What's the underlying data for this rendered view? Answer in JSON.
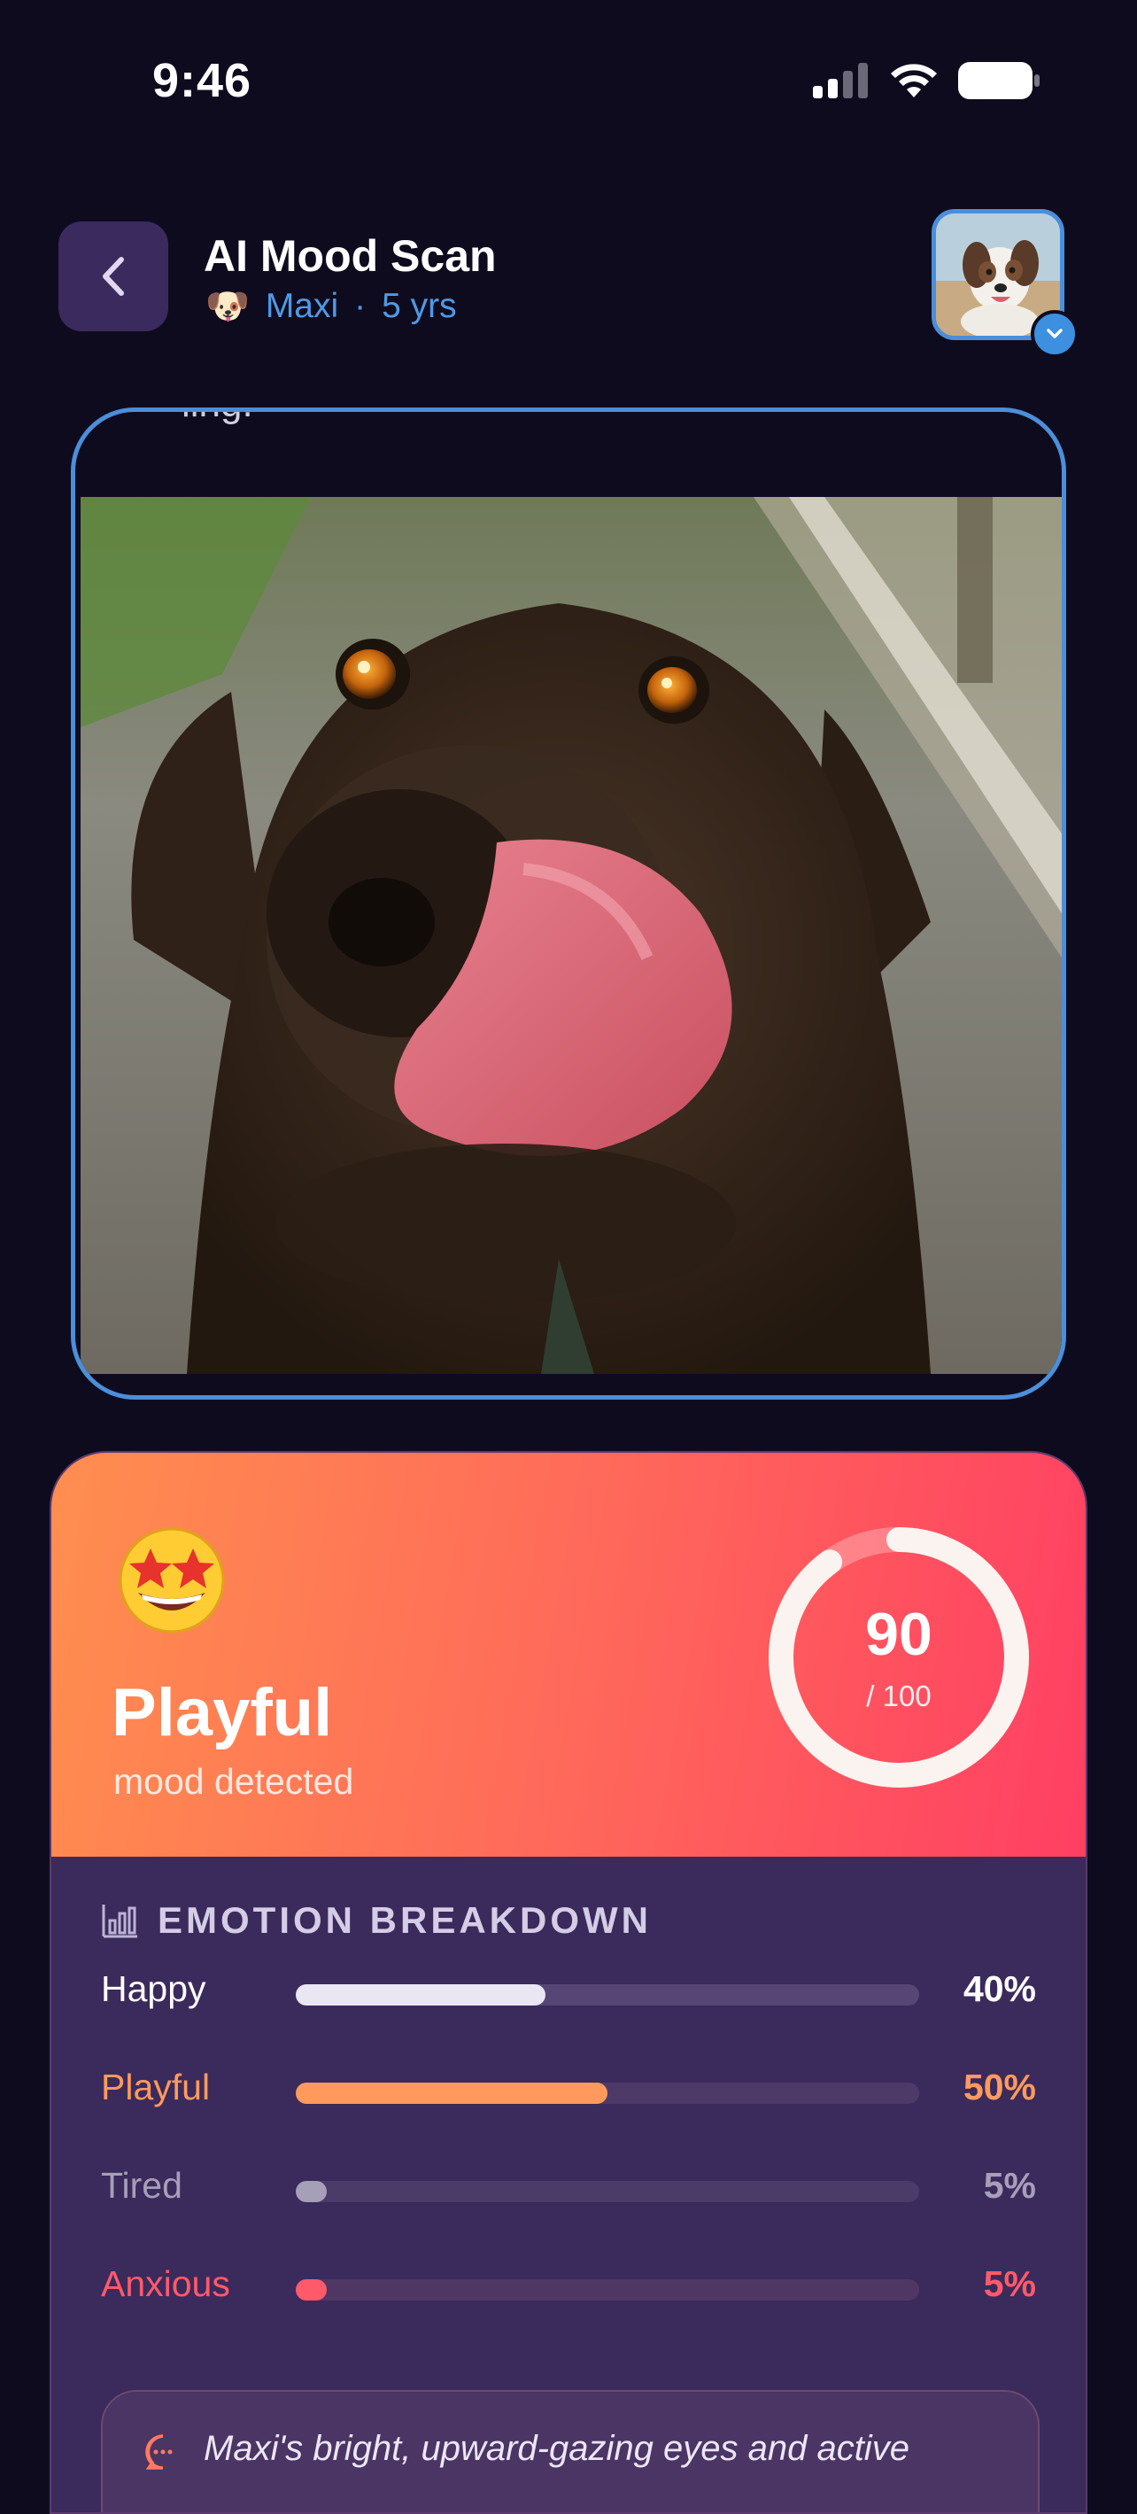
{
  "status": {
    "time": "9:46"
  },
  "header": {
    "title": "AI Mood Scan",
    "pet_name": "Maxi",
    "separator": "·",
    "pet_age": "5 yrs",
    "pet_emoji": "🐶"
  },
  "photo": {
    "caption_partial": "ling."
  },
  "result": {
    "emoji": "star-struck-face",
    "mood": "Playful",
    "mood_sub": "mood detected",
    "score": "90",
    "score_max": "/ 100",
    "score_fraction": 0.9
  },
  "breakdown": {
    "title": "EMOTION BREAKDOWN",
    "rows": [
      {
        "label": "Happy",
        "pct": "40%",
        "value": 40,
        "color": "#ffffff",
        "fill": "#ebe6f3",
        "track": "#564575"
      },
      {
        "label": "Playful",
        "pct": "50%",
        "value": 50,
        "color": "#ff9a5c",
        "fill": "#ff9a5c",
        "track": "#4e3a68"
      },
      {
        "label": "Tired",
        "pct": "5%",
        "value": 5,
        "color": "#a69fb8",
        "fill": "#a69fb8",
        "track": "#4a3b68"
      },
      {
        "label": "Anxious",
        "pct": "5%",
        "value": 5,
        "color": "#ff5a6a",
        "fill": "#ff5a6a",
        "track": "#503763"
      }
    ]
  },
  "insight": {
    "text": "Maxi's bright, upward-gazing eyes and active"
  },
  "colors": {
    "accent_blue": "#4a8fdb",
    "background": "#0f0b1e",
    "card": "#3b2a5c"
  }
}
